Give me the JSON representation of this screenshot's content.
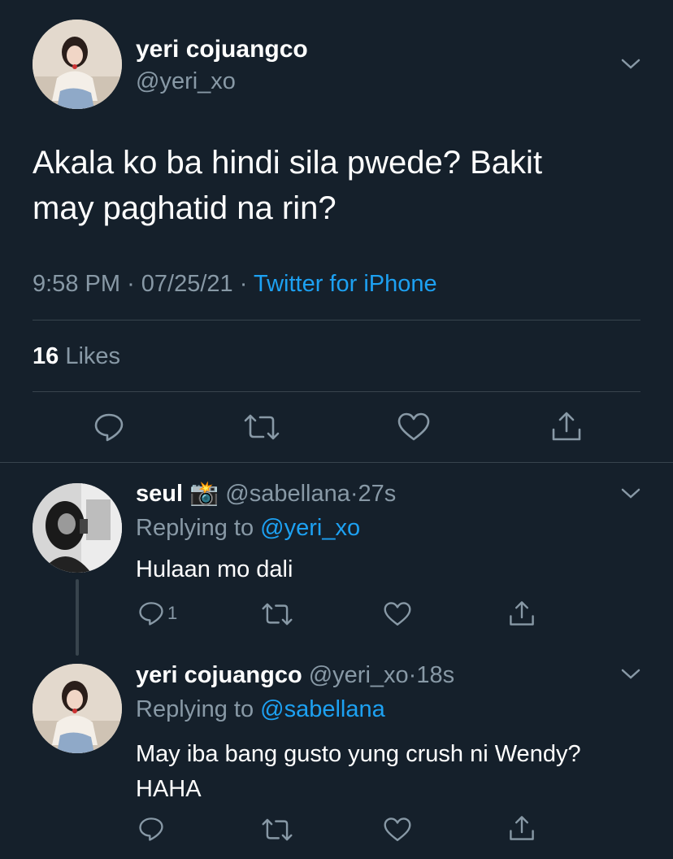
{
  "main_tweet": {
    "name": "yeri cojuangco",
    "handle": "@yeri_xo",
    "text_line1": "Akala ko ba hindi sila pwede? Bakit",
    "text_line2": "may paghatid na rin?",
    "time": "9:58 PM",
    "dot1": "·",
    "date": "07/25/21",
    "dot2": "·",
    "source": "Twitter for iPhone",
    "likes_count": "16",
    "likes_label": "Likes"
  },
  "replies": [
    {
      "name": "seul",
      "emoji": "📸",
      "handle": "@sabellana",
      "dot": "·",
      "time": "27s",
      "replying_prefix": "Replying to",
      "replying_handle": "@yeri_xo",
      "text_line1": "Hulaan mo dali",
      "reply_count": "1"
    },
    {
      "name": "yeri cojuangco",
      "handle": "@yeri_xo",
      "dot": "·",
      "time": "18s",
      "replying_prefix": "Replying to",
      "replying_handle": "@sabellana",
      "text_line1": "May iba bang gusto yung crush ni Wendy?",
      "text_line2": "HAHA"
    }
  ],
  "icons": [
    "chevron-down-icon",
    "reply-icon",
    "retweet-icon",
    "like-icon",
    "share-icon"
  ],
  "colors": {
    "background": "#15202b",
    "muted": "#8899a6",
    "link": "#1da1f2",
    "divider": "#38444d"
  }
}
